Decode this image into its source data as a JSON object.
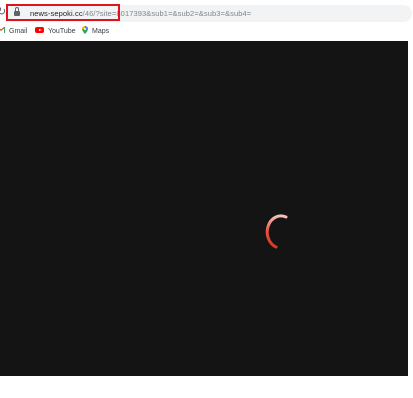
{
  "browser": {
    "url_domain": "news-sepoki.cc",
    "url_path": "/46/?site=8017393&sub1=&sub2=&sub3=&sub4=",
    "bookmarks": [
      {
        "label": "Gmail",
        "icon": "gmail-icon"
      },
      {
        "label": "YouTube",
        "icon": "youtube-icon"
      },
      {
        "label": "Maps",
        "icon": "maps-icon"
      }
    ]
  },
  "page": {
    "background": "#141414",
    "loading_indicator": "loading-spinner",
    "spinner_color": "#e8503a"
  },
  "annotation": {
    "highlight_color": "#e0121b"
  }
}
